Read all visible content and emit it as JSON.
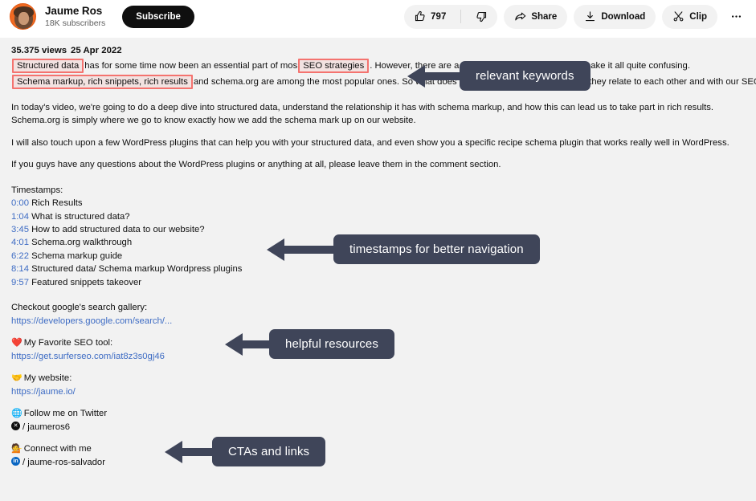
{
  "channel": {
    "name": "Jaume Ros",
    "subscribers": "18K subscribers",
    "subscribe_label": "Subscribe",
    "avatar_ring_color": "#ef6a22"
  },
  "actions": {
    "like_count": "797",
    "share_label": "Share",
    "download_label": "Download",
    "clip_label": "Clip",
    "more_label": "•••"
  },
  "description": {
    "views": "35.375 views",
    "date": "25 Apr 2022",
    "intro": {
      "hl1": "Structured data",
      "t1": "has for some time now been an essential part of mos",
      "hl2": "SEO strategies",
      "t2": ". However, there are a lot of terms and concepts that make it all quite confusing."
    },
    "intro2": {
      "hl3": "Schema markup, rich snippets, rich results",
      "t3": "and schema.org are among the most popular ones. So what does each of them mean and how do they relate to each other and with our SEO?"
    },
    "p1_line1": "In today's video, we're going to do a deep dive into structured data, understand the relationship it has with schema markup, and how this can lead us to take part in rich results.",
    "p1_line2": "Schema.org is simply where we go to know exactly how we add the schema mark up on our website.",
    "p2": "I will also touch upon a few WordPress plugins that can help you with your structured data, and even show you a specific recipe schema plugin that works really well in WordPress.",
    "p3": "If you guys have any questions about the WordPress plugins or anything at all, please leave them in the comment section.",
    "timestamps_label": "Timestamps:",
    "timestamps": [
      {
        "time": "0:00",
        "title": "Rich Results"
      },
      {
        "time": "1:04",
        "title": "What is structured data?"
      },
      {
        "time": "3:45",
        "title": "How to add structured data to our website?"
      },
      {
        "time": "4:01",
        "title": "Schema.org walkthrough"
      },
      {
        "time": "6:22",
        "title": "Schema markup guide"
      },
      {
        "time": "8:14",
        "title": "Structured data/ Schema markup Wordpress plugins"
      },
      {
        "time": "9:57",
        "title": "Featured snippets takeover"
      }
    ],
    "resources": [
      {
        "emoji": "",
        "label": "Checkout google's search gallery:",
        "url": "https://developers.google.com/search/..."
      },
      {
        "emoji": "❤️",
        "label": "My Favorite SEO tool:",
        "url": "https://get.surferseo.com/iat8z3s0gj46"
      },
      {
        "emoji": "🤝",
        "label": "My website:",
        "url": "https://jaume.io/"
      }
    ],
    "socials": [
      {
        "emoji": "🌐",
        "label": "Follow me on Twitter",
        "icon": "x-icon",
        "handle": "/ jaumeros6"
      },
      {
        "emoji": "💁",
        "label": "Connect with me",
        "icon": "linkedin-icon",
        "handle": "/ jaume-ros-salvador"
      }
    ]
  },
  "annotations": {
    "accent_color": "#3f4559",
    "highlight_color": "#f4736f",
    "items": [
      {
        "label": "relevant keywords"
      },
      {
        "label": "timestamps for better navigation"
      },
      {
        "label": "helpful resources"
      },
      {
        "label": "CTAs and links"
      }
    ]
  }
}
